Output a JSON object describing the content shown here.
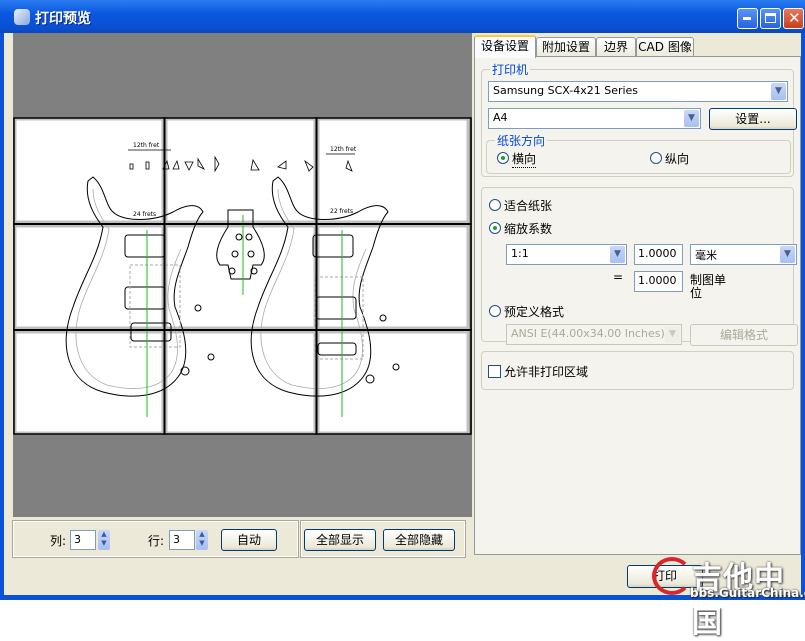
{
  "window": {
    "title": "打印预览",
    "controls": {
      "minimize": "_",
      "maximize": "□",
      "close": "✕"
    }
  },
  "preview": {
    "columns_label": "列:",
    "columns_value": "3",
    "rows_label": "行:",
    "rows_value": "3",
    "auto_button": "自动",
    "show_all_button": "全部显示",
    "hide_all_button": "全部隐藏",
    "drawing_labels": {
      "left_neck_note": "12th fret",
      "right_neck_note": "12th fret",
      "left_body_note": "24 frets",
      "right_body_note": "22 frets"
    }
  },
  "tabs": [
    {
      "label": "设备设置",
      "active": true
    },
    {
      "label": "附加设置",
      "active": false
    },
    {
      "label": "边界",
      "active": false
    },
    {
      "label": "CAD 图像",
      "active": false
    }
  ],
  "printer": {
    "group_label": "打印机",
    "printer_name": "Samsung SCX-4x21 Series",
    "paper_size": "A4",
    "settings_button": "设置...",
    "orientation_label": "纸张方向",
    "landscape_label": "横向",
    "portrait_label": "纵向",
    "orientation_selected": "landscape"
  },
  "scale": {
    "fit_to_page_label": "适合纸张",
    "scale_factor_label": "缩放系数",
    "selected_mode": "scale_factor",
    "ratio": "1:1",
    "printed_value": "1.0000",
    "unit": "毫米",
    "equals": "=",
    "drawing_value": "1.0000",
    "drawing_units_label": "制图单位",
    "predefined_label": "预定义格式",
    "predefined_format": "ANSI E(44.00x34.00 Inches)",
    "edit_format_button": "编辑格式"
  },
  "options": {
    "allow_nonprint_label": "允许非打印区域",
    "allow_nonprint_checked": false
  },
  "footer": {
    "print_button": "打印"
  },
  "watermark": {
    "text": "吉他中国",
    "url": "bbs.GuitarChina.com"
  }
}
